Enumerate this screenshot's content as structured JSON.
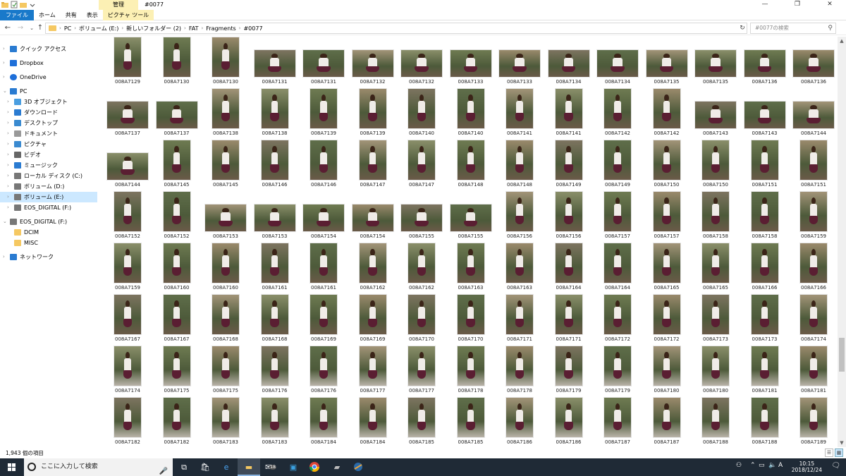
{
  "window": {
    "title": "#0077",
    "manage_tab": "管理",
    "controls": {
      "minimize": "—",
      "maximize": "❐",
      "close": "✕"
    }
  },
  "ribbon": {
    "tabs": [
      "ファイル",
      "ホーム",
      "共有",
      "表示",
      "ピクチャ ツール"
    ],
    "help": "⌄ ?"
  },
  "address": {
    "path": [
      "PC",
      "ボリューム (E:)",
      "新しいフォルダー (2)",
      "FAT",
      "Fragments",
      "#0077"
    ],
    "search_placeholder": "#0077の検索"
  },
  "nav": {
    "items": [
      {
        "label": "クイック アクセス",
        "icon": "star-icon"
      },
      {
        "label": "Dropbox",
        "icon": "dropbox-icon"
      },
      {
        "label": "OneDrive",
        "icon": "cloud-icon"
      },
      {
        "label": "PC",
        "icon": "computer-icon"
      },
      {
        "label": "3D オブジェクト",
        "icon": "cube-icon"
      },
      {
        "label": "ダウンロード",
        "icon": "download-icon"
      },
      {
        "label": "デスクトップ",
        "icon": "desktop-icon"
      },
      {
        "label": "ドキュメント",
        "icon": "document-icon"
      },
      {
        "label": "ピクチャ",
        "icon": "picture-icon"
      },
      {
        "label": "ビデオ",
        "icon": "video-icon"
      },
      {
        "label": "ミュージック",
        "icon": "music-icon"
      },
      {
        "label": "ローカル ディスク (C:)",
        "icon": "drive-icon"
      },
      {
        "label": "ボリューム (D:)",
        "icon": "drive-icon"
      },
      {
        "label": "ボリューム (E:)",
        "icon": "drive-icon"
      },
      {
        "label": "EOS_DIGITAL (F:)",
        "icon": "drive-icon"
      },
      {
        "label": "EOS_DIGITAL (F:)",
        "icon": "removable-drive-icon"
      },
      {
        "label": "DCIM",
        "icon": "folder-icon"
      },
      {
        "label": "MISC",
        "icon": "folder-icon"
      },
      {
        "label": "ネットワーク",
        "icon": "network-icon"
      }
    ]
  },
  "files": [
    [
      "008A7129",
      "008A7130",
      "008A7130",
      "008A7131",
      "008A7131",
      "008A7132",
      "008A7132",
      "008A7133",
      "008A7133",
      "008A7134",
      "008A7134",
      "008A7135",
      "008A7135",
      "008A7136",
      "008A7136"
    ],
    [
      "008A7137",
      "008A7137",
      "008A7138",
      "008A7138",
      "008A7139",
      "008A7139",
      "008A7140",
      "008A7140",
      "008A7141",
      "008A7141",
      "008A7142",
      "008A7142",
      "008A7143",
      "008A7143",
      "008A7144"
    ],
    [
      "008A7144",
      "008A7145",
      "008A7145",
      "008A7146",
      "008A7146",
      "008A7147",
      "008A7147",
      "008A7148",
      "008A7148",
      "008A7149",
      "008A7149",
      "008A7150",
      "008A7150",
      "008A7151",
      "008A7151"
    ],
    [
      "008A7152",
      "008A7152",
      "008A7153",
      "008A7153",
      "008A7154",
      "008A7154",
      "008A7155",
      "008A7155",
      "008A7156",
      "008A7156",
      "008A7157",
      "008A7157",
      "008A7158",
      "008A7158",
      "008A7159"
    ],
    [
      "008A7159",
      "008A7160",
      "008A7160",
      "008A7161",
      "008A7161",
      "008A7162",
      "008A7162",
      "008A7163",
      "008A7163",
      "008A7164",
      "008A7164",
      "008A7165",
      "008A7165",
      "008A7166",
      "008A7166"
    ],
    [
      "008A7167",
      "008A7167",
      "008A7168",
      "008A7168",
      "008A7169",
      "008A7169",
      "008A7170",
      "008A7170",
      "008A7171",
      "008A7171",
      "008A7172",
      "008A7172",
      "008A7173",
      "008A7173",
      "008A7174"
    ],
    [
      "008A7174",
      "008A7175",
      "008A7175",
      "008A7176",
      "008A7176",
      "008A7177",
      "008A7177",
      "008A7178",
      "008A7178",
      "008A7179",
      "008A7179",
      "008A7180",
      "008A7180",
      "008A7181",
      "008A7181"
    ],
    [
      "008A7182",
      "008A7182",
      "008A7183",
      "008A7183",
      "008A7184",
      "008A7184",
      "008A7185",
      "008A7185",
      "008A7186",
      "008A7186",
      "008A7187",
      "008A7187",
      "008A7188",
      "008A7188",
      "008A7189"
    ]
  ],
  "landscape": [
    [
      3,
      4,
      5,
      6,
      7,
      8,
      9,
      10,
      11,
      12,
      13,
      14
    ],
    [
      0,
      1,
      12,
      13,
      14
    ],
    [
      0
    ],
    [
      2,
      3,
      4,
      5,
      6,
      7
    ],
    [],
    [],
    [],
    []
  ],
  "status": {
    "item_count": "1,943 個の項目"
  },
  "taskbar": {
    "search_placeholder": "ここに入力して検索",
    "time": "10:15",
    "date": "2018/12/24",
    "ime": "A",
    "mail_badge": "18"
  }
}
